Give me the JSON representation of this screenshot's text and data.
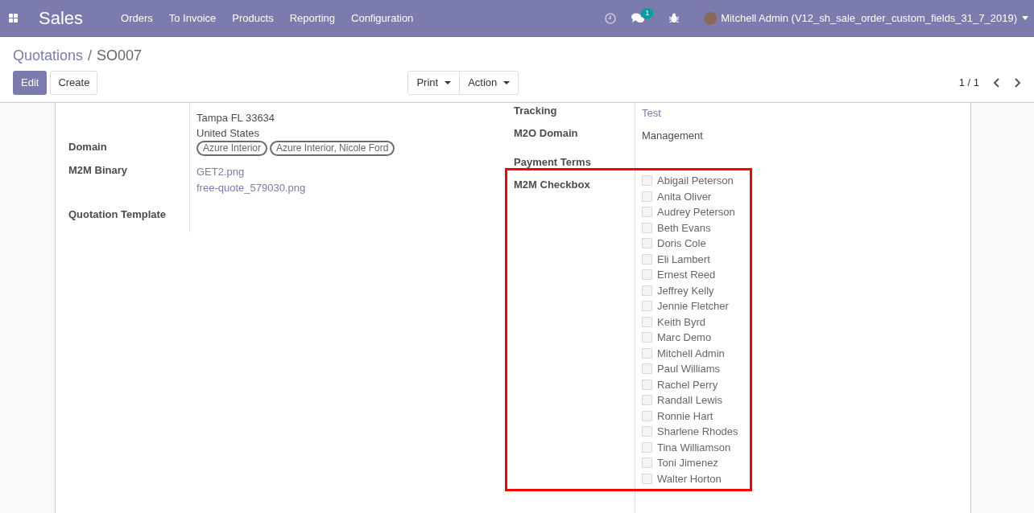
{
  "navbar": {
    "app_name": "Sales",
    "menu": [
      "Orders",
      "To Invoice",
      "Products",
      "Reporting",
      "Configuration"
    ],
    "messages_badge": "1",
    "user": "Mitchell Admin (V12_sh_sale_order_custom_fields_31_7_2019)"
  },
  "breadcrumb": {
    "parent": "Quotations",
    "separator": "/",
    "current": "SO007"
  },
  "buttons": {
    "edit": "Edit",
    "create": "Create",
    "print": "Print",
    "action": "Action"
  },
  "pager": "1 / 1",
  "left_fields": [
    {
      "kind": "text",
      "values": [
        "Tampa FL 33634",
        "United States"
      ]
    },
    {
      "kind": "tags",
      "label": "Domain",
      "values": [
        "Azure Interior",
        "Azure Interior, Nicole Ford"
      ]
    },
    {
      "kind": "links",
      "label": "M2M Binary",
      "values": [
        "GET2.png",
        "free-quote_579030.png"
      ]
    },
    {
      "kind": "text",
      "label": "Quotation Template"
    }
  ],
  "right_fields": [
    {
      "kind": "links",
      "label": "Tracking",
      "values": [
        "Test"
      ]
    },
    {
      "kind": "text",
      "label": "M2O Domain",
      "values": [
        "Management"
      ]
    },
    {
      "kind": "text",
      "label": "Payment Terms"
    }
  ],
  "checkbox_field": {
    "label": "M2M Checkbox",
    "highlighted": true,
    "options": [
      {
        "label": "Abigail Peterson",
        "checked": false
      },
      {
        "label": "Anita Oliver",
        "checked": false
      },
      {
        "label": "Audrey Peterson",
        "checked": false
      },
      {
        "label": "Beth Evans",
        "checked": false
      },
      {
        "label": "Doris Cole",
        "checked": false
      },
      {
        "label": "Eli Lambert",
        "checked": false
      },
      {
        "label": "Ernest Reed",
        "checked": false
      },
      {
        "label": "Jeffrey Kelly",
        "checked": false
      },
      {
        "label": "Jennie Fletcher",
        "checked": false
      },
      {
        "label": "Keith Byrd",
        "checked": false
      },
      {
        "label": "Marc Demo",
        "checked": false
      },
      {
        "label": "Mitchell Admin",
        "checked": false
      },
      {
        "label": "Paul Williams",
        "checked": false
      },
      {
        "label": "Rachel Perry",
        "checked": false
      },
      {
        "label": "Randall Lewis",
        "checked": false
      },
      {
        "label": "Ronnie Hart",
        "checked": false
      },
      {
        "label": "Sharlene Rhodes",
        "checked": false
      },
      {
        "label": "Tina Williamson",
        "checked": false
      },
      {
        "label": "Toni Jimenez",
        "checked": false
      },
      {
        "label": "Walter Horton",
        "checked": false
      }
    ]
  }
}
